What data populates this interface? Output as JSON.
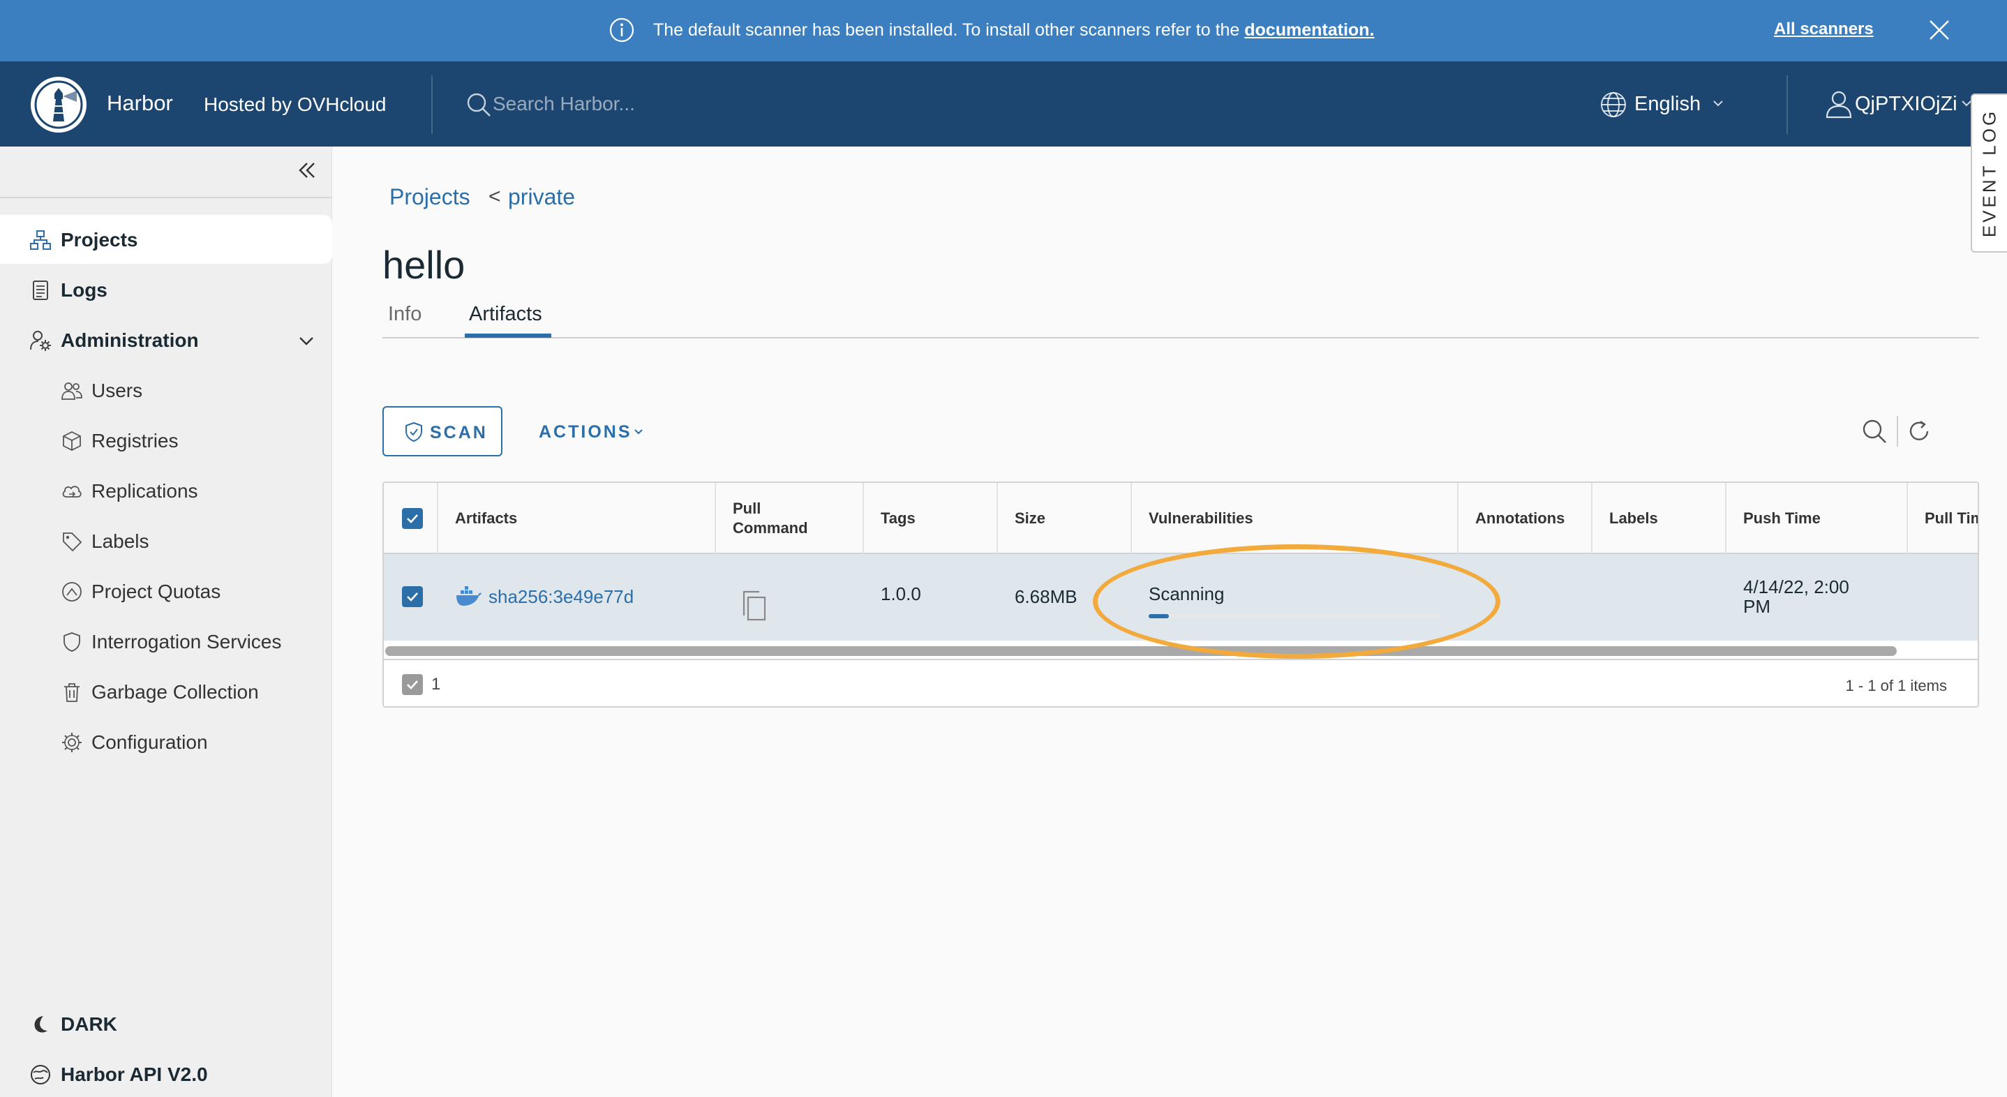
{
  "banner": {
    "message": "The default scanner has been installed. To install other scanners refer to the ",
    "link_text": "documentation.",
    "all_scanners": "All scanners"
  },
  "header": {
    "brand": "Harbor",
    "hosted_by": "Hosted by OVHcloud",
    "search_placeholder": "Search Harbor...",
    "language": "English",
    "username": "QjPTXIOjZi"
  },
  "event_log": "EVENT LOG",
  "sidebar": {
    "items": [
      {
        "label": "Projects",
        "icon": "projects-icon",
        "active": true
      },
      {
        "label": "Logs",
        "icon": "logs-icon"
      },
      {
        "label": "Administration",
        "icon": "administration-icon"
      }
    ],
    "admin_items": [
      {
        "label": "Users",
        "icon": "users-icon"
      },
      {
        "label": "Registries",
        "icon": "registries-icon"
      },
      {
        "label": "Replications",
        "icon": "replications-icon"
      },
      {
        "label": "Labels",
        "icon": "labels-icon"
      },
      {
        "label": "Project Quotas",
        "icon": "project-quotas-icon"
      },
      {
        "label": "Interrogation Services",
        "icon": "interrogation-services-icon"
      },
      {
        "label": "Garbage Collection",
        "icon": "garbage-collection-icon"
      },
      {
        "label": "Configuration",
        "icon": "configuration-icon"
      }
    ],
    "dark": "DARK",
    "api": "Harbor API V2.0"
  },
  "breadcrumb": {
    "projects": "Projects",
    "separator": "<",
    "current": "private"
  },
  "page_title": "hello",
  "tabs": [
    {
      "label": "Info"
    },
    {
      "label": "Artifacts",
      "active": true
    }
  ],
  "toolbar": {
    "scan": "SCAN",
    "actions": "ACTIONS"
  },
  "table": {
    "columns": [
      "Artifacts",
      "Pull Command",
      "Tags",
      "Size",
      "Vulnerabilities",
      "Annotations",
      "Labels",
      "Push Time",
      "Pull Time"
    ],
    "columns_display": {
      "artifacts": "Artifacts",
      "pull_command_1": "Pull",
      "pull_command_2": "Command",
      "tags": "Tags",
      "size": "Size",
      "vulnerabilities": "Vulnerabilities",
      "annotations": "Annotations",
      "labels": "Labels",
      "push_time": "Push Time",
      "pull_time": "Pull Tim"
    },
    "rows": [
      {
        "artifact": "sha256:3e49e77d",
        "tags": "1.0.0",
        "size": "6.68MB",
        "vulnerabilities": "Scanning",
        "scan_progress_percent": 7,
        "push_time_1": "4/14/22, 2:00",
        "push_time_2": "PM",
        "selected": true
      }
    ],
    "footer": {
      "selected_count": "1",
      "pagination": "1 - 1 of 1 items"
    }
  },
  "colors": {
    "banner": "#3b7fc0",
    "header": "#1c4670",
    "accent": "#2c6fa8",
    "highlight": "#f2aa3c"
  }
}
